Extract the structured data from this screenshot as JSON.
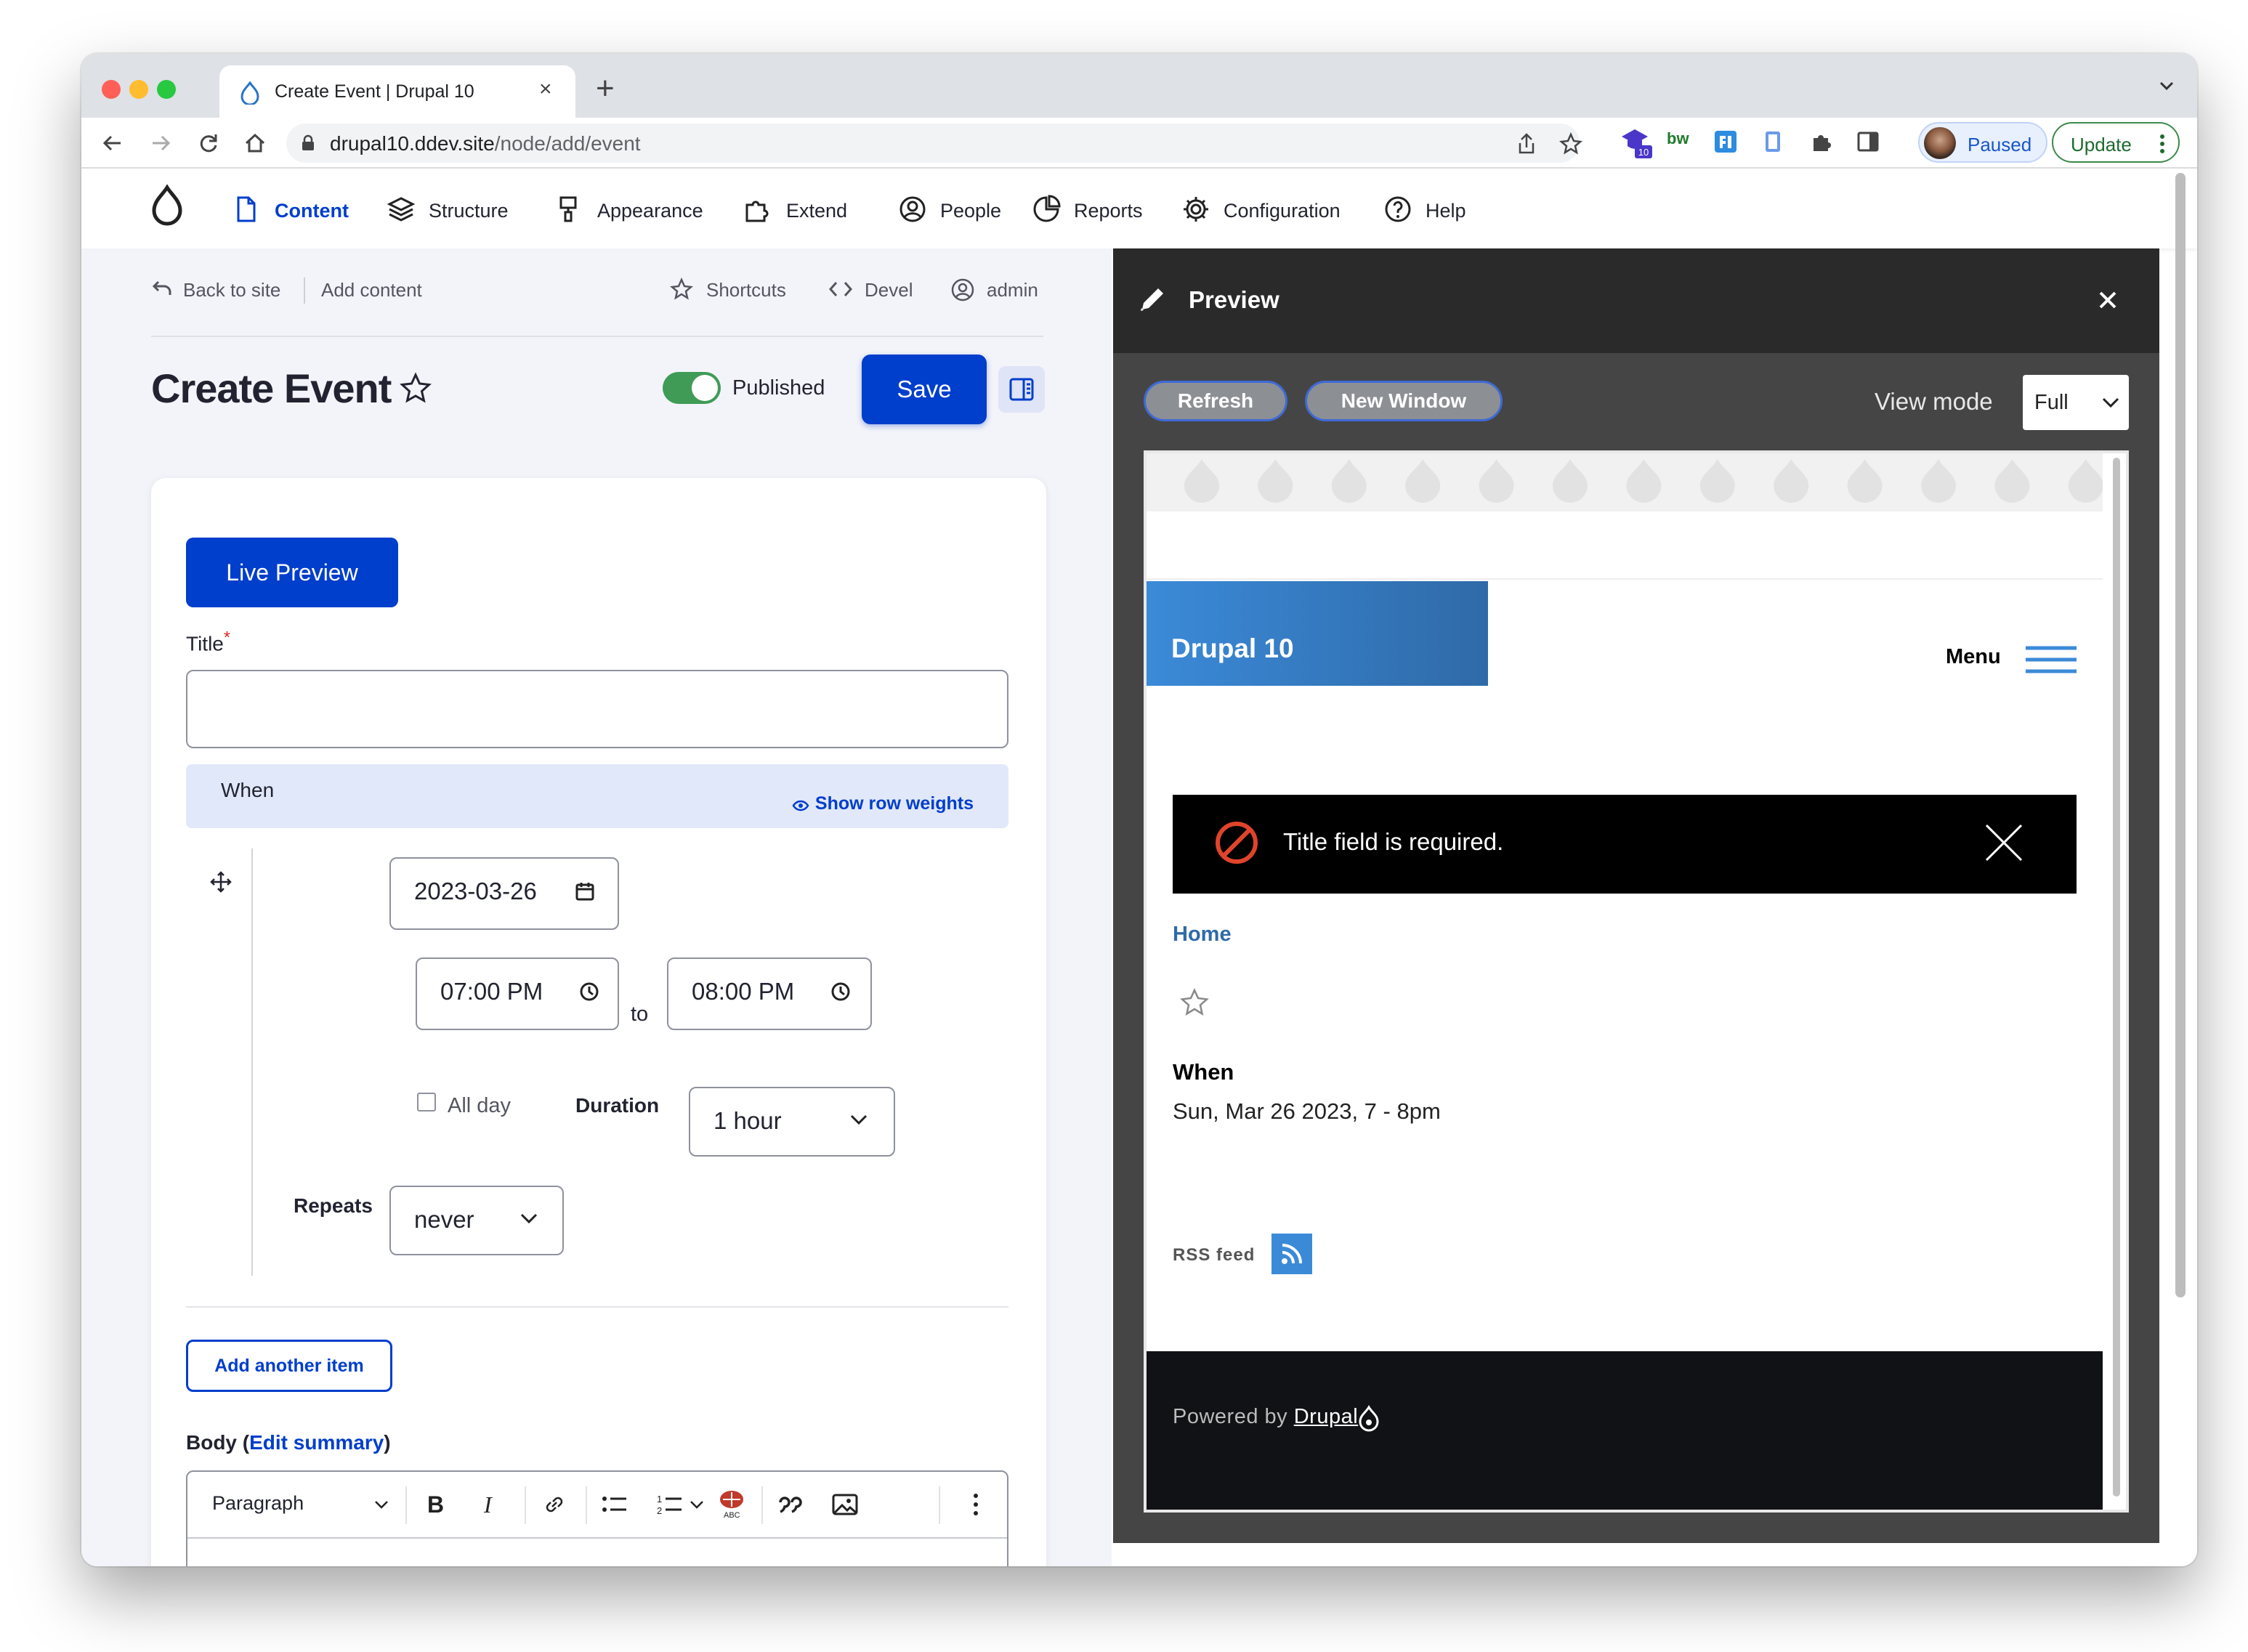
{
  "browser": {
    "tab_title": "Create Event | Drupal 10",
    "url_host": "drupal10.ddev.site",
    "url_path": "/node/add/event",
    "profile_label": "Paused",
    "update_label": "Update",
    "extension_badge": "10",
    "extension_bw": "bw"
  },
  "admin_menu": [
    {
      "label": "Content",
      "icon": "content-icon",
      "active": true
    },
    {
      "label": "Structure",
      "icon": "structure-icon"
    },
    {
      "label": "Appearance",
      "icon": "appearance-icon"
    },
    {
      "label": "Extend",
      "icon": "extend-icon"
    },
    {
      "label": "People",
      "icon": "people-icon"
    },
    {
      "label": "Reports",
      "icon": "reports-icon"
    },
    {
      "label": "Configuration",
      "icon": "gear-icon"
    },
    {
      "label": "Help",
      "icon": "help-icon"
    }
  ],
  "secondary_nav": {
    "back": "Back to site",
    "add_content": "Add content",
    "shortcuts": "Shortcuts",
    "devel": "Devel",
    "user": "admin"
  },
  "page": {
    "title": "Create Event",
    "published_label": "Published",
    "published": true,
    "save_label": "Save"
  },
  "form": {
    "live_preview": "Live Preview",
    "title_label": "Title",
    "title_required": "*",
    "title_value": "",
    "when_label": "When",
    "show_row_weights": "Show row weights",
    "date": "2023-03-26",
    "start_time": "07:00 PM",
    "to_label": "to",
    "end_time": "08:00 PM",
    "all_day_label": "All day",
    "all_day_checked": false,
    "duration_label": "Duration",
    "duration_value": "1 hour",
    "repeats_label": "Repeats",
    "repeats_value": "never",
    "add_another_item": "Add another item",
    "body_label": "Body",
    "body_paren_open": "(",
    "edit_summary": "Edit summary",
    "body_paren_close": ")",
    "editor_format": "Paragraph"
  },
  "preview": {
    "title": "Preview",
    "refresh": "Refresh",
    "new_window": "New Window",
    "view_mode_label": "View mode",
    "view_mode_value": "Full",
    "site_name": "Drupal 10",
    "menu_label": "Menu",
    "alert_message": "Title field is required.",
    "breadcrumb_home": "Home",
    "when_label": "When",
    "when_value": "Sun, Mar 26 2023, 7 - 8pm",
    "rss_label": "RSS feed",
    "powered_by": "Powered by",
    "drupal_link": "Drupal"
  },
  "colors": {
    "accent": "#003ecc",
    "published_green": "#3f9b56",
    "site_blue": "#3b8ad8",
    "alert_red": "#e0442b"
  }
}
